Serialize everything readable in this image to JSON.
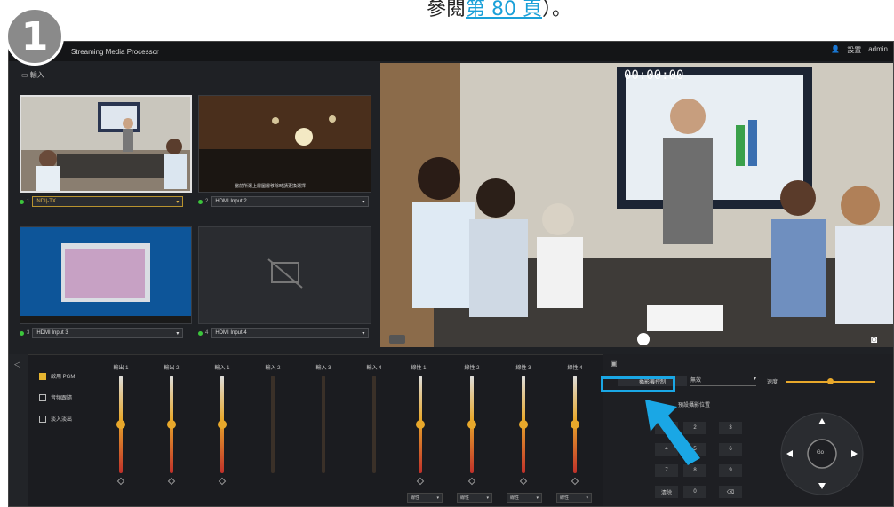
{
  "doc": {
    "prefix": "參閱",
    "link": "第 80 頁",
    "suffix": "）。"
  },
  "step_number": "1",
  "app": {
    "title": "Streaming Media Processor",
    "header_right": [
      "設置",
      "admin"
    ],
    "input_title": "輸入",
    "timecode": "00:00:00",
    "inputs": [
      {
        "num": "1",
        "name": "NDI|-TX",
        "active": true
      },
      {
        "num": "2",
        "name": "HDMI Input 2",
        "active": false
      },
      {
        "num": "3",
        "name": "HDMI Input 3",
        "active": false
      },
      {
        "num": "4",
        "name": "HDMI Input 4",
        "active": false
      }
    ],
    "input2_caption": "當前所選上層圖層移除時請更換選擇",
    "checkboxes": [
      {
        "label": "啟用 PGM",
        "checked": true
      },
      {
        "label": "音頻跟隨",
        "checked": false
      },
      {
        "label": "淡入淡出",
        "checked": false
      }
    ],
    "channels": [
      "輸出 1",
      "輸出 2",
      "輸入 1",
      "輸入 2",
      "輸入 3",
      "輸入 4",
      "線性 1",
      "線性 2",
      "線性 3",
      "線性 4"
    ],
    "channel_dropdowns": [
      "線性",
      "線性",
      "線性",
      "線性"
    ],
    "ptz": {
      "source_label": "攝影機控制",
      "dropdown": "無效",
      "speed_label": "速度",
      "preset_title": "預設攝影位置",
      "keys": [
        "1",
        "2",
        "3",
        "4",
        "5",
        "6",
        "7",
        "8",
        "9",
        "清除",
        "0",
        "⌫"
      ],
      "center": "Go"
    }
  },
  "colors": {
    "accent": "#1aa7e5",
    "fader": "#e8a82b",
    "link": "#1aa0d8"
  }
}
